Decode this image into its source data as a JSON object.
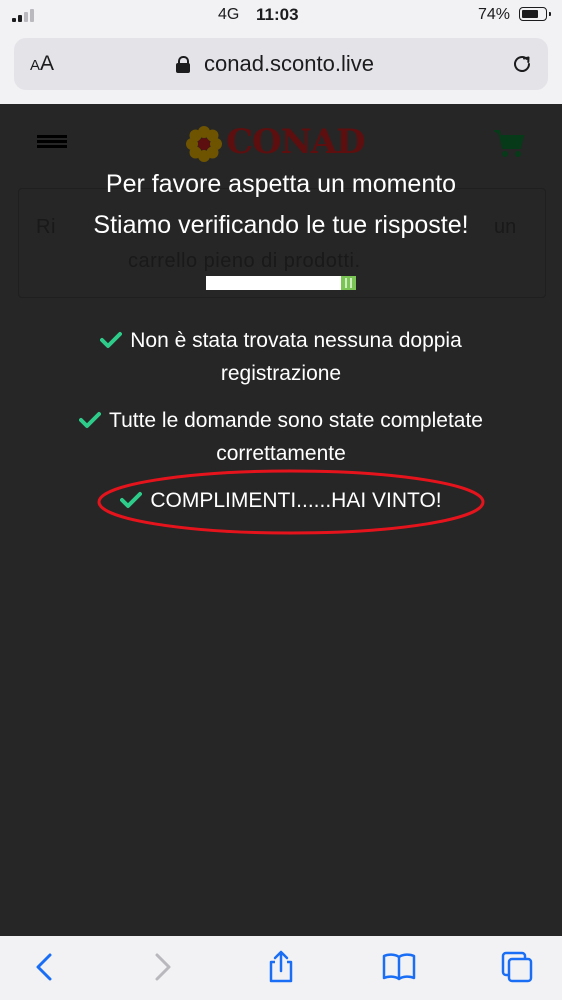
{
  "status_bar": {
    "carrier": "4G",
    "time": "11:03",
    "battery_percent": "74%",
    "battery_level": 0.74,
    "signal_bars": 2
  },
  "browser": {
    "text_size_small": "A",
    "text_size_large": "A",
    "url": "conad.sconto.live",
    "icons": [
      "lock-icon",
      "reload-icon"
    ]
  },
  "site": {
    "logo_text": "CONAD",
    "bg_text_line1_start": "Ri",
    "bg_text_line1_end": "un",
    "bg_text_line2": "carrello pieno di prodotti.",
    "icons": [
      "hamburger-menu-icon",
      "cart-icon",
      "flower-logo-icon"
    ]
  },
  "overlay": {
    "title_line1": "Per favore aspetta un momento",
    "title_line2": "Stiamo verificando le tue risposte!",
    "progress": 0.1,
    "checks": [
      {
        "line1": "Non è stata trovata nessuna doppia",
        "line2": "registrazione"
      },
      {
        "line1": "Tutte le domande sono state completate",
        "line2": "correttamente"
      },
      {
        "line1": "COMPLIMENTI......HAI VINTO!"
      }
    ],
    "accent_color": "#2ecc8a",
    "highlight_color": "#e5141c"
  },
  "toolbar": {
    "icons": [
      "back-icon",
      "forward-icon",
      "share-icon",
      "bookmarks-icon",
      "tabs-icon"
    ]
  }
}
